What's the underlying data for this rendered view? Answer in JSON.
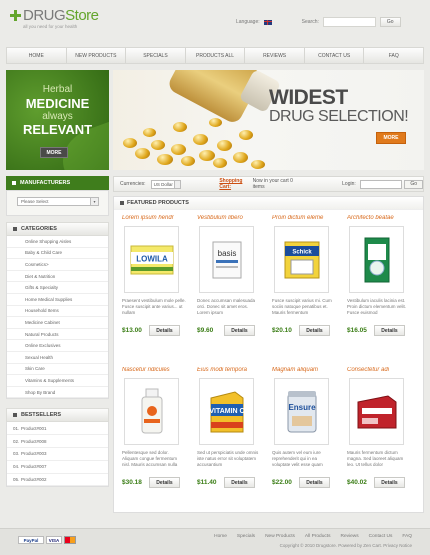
{
  "header": {
    "logo_part1": "DRUG",
    "logo_part2": "Store",
    "tagline": "all you need for your health",
    "language_label": "Language:",
    "search_label": "Search:",
    "go_label": "Go"
  },
  "nav": [
    "HOME",
    "NEW PRODUCTS",
    "SPECIALS",
    "PRODUCTS ALL",
    "REVIEWS",
    "CONTACT US",
    "FAQ"
  ],
  "banner_left": {
    "line1": "Herbal",
    "line2": "MEDICINE",
    "line3": "always",
    "line4": "RELEVANT",
    "more": "MORE"
  },
  "banner_right": {
    "line1": "WIDEST",
    "line2": "DRUG SELECTION!",
    "more": "MORE"
  },
  "sidebar": {
    "manufacturers_title": "MANUFACTURERS",
    "manufacturers_select": "Please Select",
    "categories_title": "CATEGORIES",
    "categories": [
      "Online Shopping Aisles",
      "Baby & Child Care",
      "Cosmetics>",
      "Diet & Nutrition",
      "Gifts & Specialty",
      "Home Medical Supplies",
      "Household Items",
      "Medicine Cabinet",
      "Natural Products",
      "Online Exclusives",
      "Sexual Health",
      "Skin Care",
      "Vitamins & Supplements",
      "Shop By Brand"
    ],
    "bestsellers_title": "BESTSELLERS",
    "bestsellers": [
      {
        "n": "01.",
        "name": "Product#001"
      },
      {
        "n": "02.",
        "name": "Product#008"
      },
      {
        "n": "03.",
        "name": "Product#003"
      },
      {
        "n": "04.",
        "name": "Product#007"
      },
      {
        "n": "05.",
        "name": "Product#002"
      }
    ]
  },
  "bar": {
    "currencies_label": "Currencies:",
    "currency": "US Dollar",
    "cart_label": "Shopping Cart:",
    "cart_text": "Now in your cart 0 items",
    "login_label": "Login:",
    "go": "Go"
  },
  "main": {
    "title": "FEATURED PRODUCTS",
    "details": "Details",
    "products": [
      {
        "title": "Lorem ipsum hendr",
        "desc": "Praesent vestibulum mole pelle. Fusce suscipit ante varius... ut nullam",
        "price": "$13.00"
      },
      {
        "title": "Vestibulum libero",
        "desc": "Donec accumsan malesuada orci. Donec sit amet eros. Lorem ipsum",
        "price": "$9.60"
      },
      {
        "title": "Proin dictum eleme",
        "desc": "Fusce suscipit varius mi. Cum sociis natoque penatibus et. Mauris fermentum",
        "price": "$20.10"
      },
      {
        "title": "Archifecto beatae",
        "desc": "Vestibulum iaculis lacinia est. Proin dictum elementum velit. Fusce euismod",
        "price": "$16.05"
      },
      {
        "title": "Nascetur ridicules",
        "desc": "Pellentesque sed dolor. Aliquam congue fermentum nisl. Mauris accumsan nulla",
        "price": "$30.18"
      },
      {
        "title": "Eius modi tempora",
        "desc": "Sed ut perspiciatis unde omnis iste natus error sit voluptatem accusantium",
        "price": "$11.40"
      },
      {
        "title": "Magnam aliquam",
        "desc": "Quis autem vel eum iure reprehenderit qui in ea voluptate velit esse quam",
        "price": "$22.00"
      },
      {
        "title": "Consectetur adi",
        "desc": "Mauris fermentum dictum magna. Sed laoreet aliquam leo. Ut tellus dolor",
        "price": "$40.02"
      }
    ]
  },
  "footer": {
    "links": [
      "Home",
      "Specials",
      "New Products",
      "All Products",
      "Reviews",
      "Contact Us",
      "FAQ"
    ],
    "copyright": "Copyright © 2010 Drugstore. Powered by Zen Cart. Privacy Notice",
    "paypal": "PayPal",
    "visa": "VISA"
  },
  "colors": {
    "accent": "#63a52c",
    "orange": "#d8691b",
    "dark_green": "#3f7d1c"
  }
}
